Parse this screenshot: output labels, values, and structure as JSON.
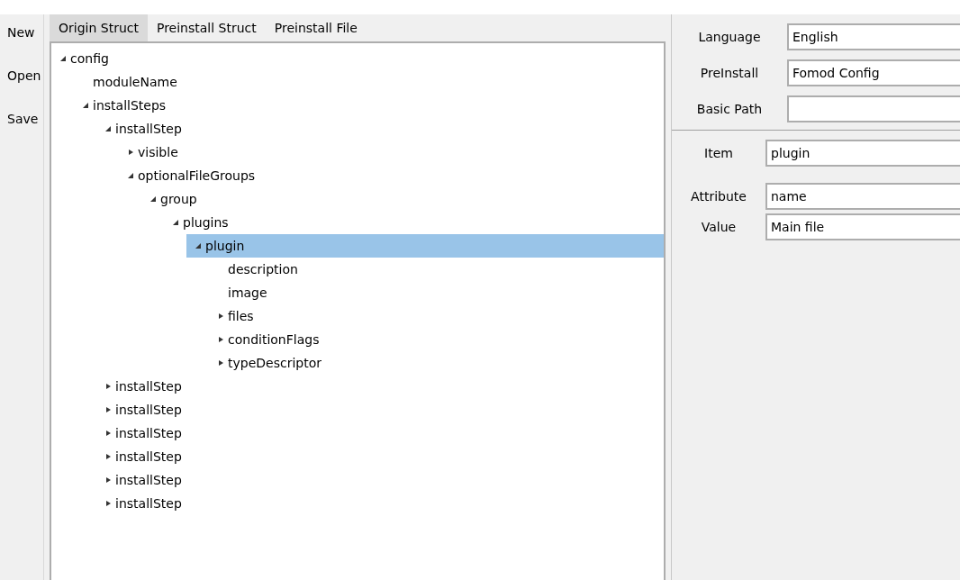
{
  "toolbar": [
    "New",
    "Open",
    "Save"
  ],
  "tabs": [
    {
      "label": "Origin Struct",
      "selected": true
    },
    {
      "label": "Preinstall Struct",
      "selected": false
    },
    {
      "label": "Preinstall File",
      "selected": false
    }
  ],
  "tree": [
    {
      "label": "config",
      "kind": "node",
      "expanded": true,
      "selected": false,
      "children": [
        {
          "label": "moduleName",
          "kind": "leaf",
          "selected": false
        },
        {
          "label": "installSteps",
          "kind": "node",
          "expanded": true,
          "selected": false,
          "children": [
            {
              "label": "installStep",
              "kind": "node",
              "expanded": true,
              "selected": false,
              "children": [
                {
                  "label": "visible",
                  "kind": "node",
                  "expanded": false,
                  "selected": false
                },
                {
                  "label": "optionalFileGroups",
                  "kind": "node",
                  "expanded": true,
                  "selected": false,
                  "children": [
                    {
                      "label": "group",
                      "kind": "node",
                      "expanded": true,
                      "selected": false,
                      "children": [
                        {
                          "label": "plugins",
                          "kind": "node",
                          "expanded": true,
                          "selected": false,
                          "children": [
                            {
                              "label": "plugin",
                              "kind": "node",
                              "expanded": true,
                              "selected": true,
                              "children": [
                                {
                                  "label": "description",
                                  "kind": "leaf",
                                  "selected": false
                                },
                                {
                                  "label": "image",
                                  "kind": "leaf",
                                  "selected": false
                                },
                                {
                                  "label": "files",
                                  "kind": "node",
                                  "expanded": false,
                                  "selected": false
                                },
                                {
                                  "label": "conditionFlags",
                                  "kind": "node",
                                  "expanded": false,
                                  "selected": false
                                },
                                {
                                  "label": "typeDescriptor",
                                  "kind": "node",
                                  "expanded": false,
                                  "selected": false
                                }
                              ]
                            }
                          ]
                        }
                      ]
                    }
                  ]
                }
              ]
            },
            {
              "label": "installStep",
              "kind": "node",
              "expanded": false,
              "selected": false
            },
            {
              "label": "installStep",
              "kind": "node",
              "expanded": false,
              "selected": false
            },
            {
              "label": "installStep",
              "kind": "node",
              "expanded": false,
              "selected": false
            },
            {
              "label": "installStep",
              "kind": "node",
              "expanded": false,
              "selected": false
            },
            {
              "label": "installStep",
              "kind": "node",
              "expanded": false,
              "selected": false
            },
            {
              "label": "installStep",
              "kind": "node",
              "expanded": false,
              "selected": false
            }
          ]
        }
      ]
    }
  ],
  "settings": [
    {
      "label": "Language",
      "value": "English"
    },
    {
      "label": "PreInstall",
      "value": "Fomod Config"
    },
    {
      "label": "Basic Path"
    }
  ],
  "item_editor": {
    "item": {
      "label": "Item",
      "value": "plugin"
    },
    "attribute": {
      "label": "Attribute",
      "value": "name"
    },
    "value": {
      "label": "Value",
      "value": "Main file"
    }
  }
}
